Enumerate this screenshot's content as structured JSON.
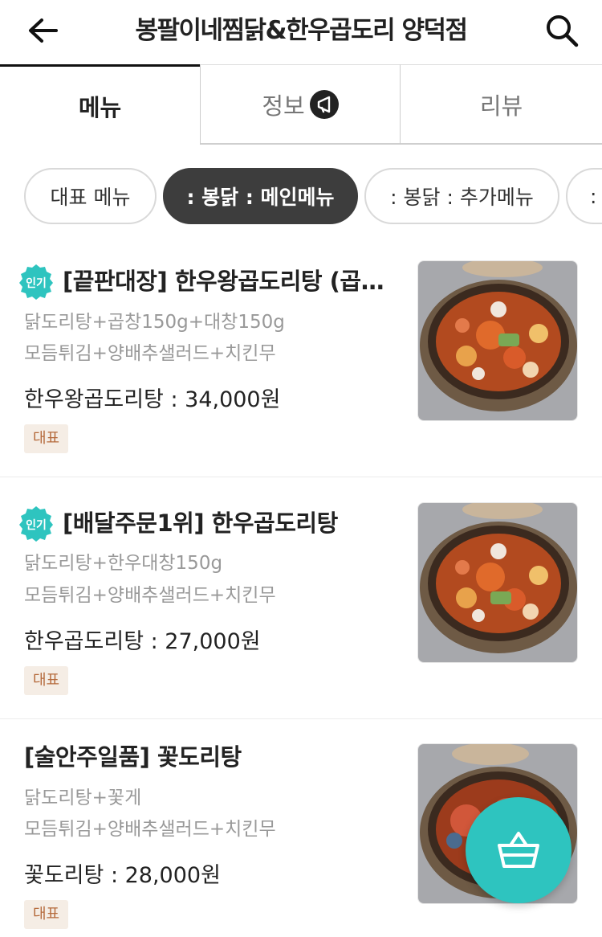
{
  "header": {
    "title": "봉팔이네찜닭&한우곱도리 양덕점",
    "back_icon": "arrow-left-icon",
    "search_icon": "search-icon"
  },
  "tabs": [
    {
      "label": "메뉴",
      "active": true
    },
    {
      "label": "정보",
      "active": false,
      "icon": "megaphone-icon"
    },
    {
      "label": "리뷰",
      "active": false
    }
  ],
  "categories": [
    {
      "label": "대표 메뉴",
      "active": false
    },
    {
      "label": ": 봉닭 : 메인메뉴",
      "active": true
    },
    {
      "label": ": 봉닭 : 추가메뉴",
      "active": false
    },
    {
      "label": ":",
      "active": false
    }
  ],
  "menu_items": [
    {
      "popular_badge": "인기",
      "name": "[끝판대장] 한우왕곱도리탕 (곱창+대창)",
      "desc_line1": "닭도리탕+곱창150g+대창150g",
      "desc_line2": "모듬튀김+양배추샐러드+치킨무",
      "price": "한우왕곱도리탕 : 34,000원",
      "tag": "대표"
    },
    {
      "popular_badge": "인기",
      "name": "[배달주문1위] 한우곱도리탕",
      "desc_line1": "닭도리탕+한우대창150g",
      "desc_line2": "모듬튀김+양배추샐러드+치킨무",
      "price": "한우곱도리탕 : 27,000원",
      "tag": "대표"
    },
    {
      "popular_badge": "",
      "name": "[술안주일품] 꽃도리탕",
      "desc_line1": "닭도리탕+꽃게",
      "desc_line2": "모듬튀김+양배추샐러드+치킨무",
      "price": "꽃도리탕 : 28,000원",
      "tag": "대표"
    }
  ],
  "cart": {
    "icon": "basket-icon"
  },
  "colors": {
    "accent": "#2ec4bf",
    "chip_active": "#3d3d3d",
    "tag_bg": "#f5ede5",
    "tag_text": "#b56a3c",
    "popular_badge": "#2ec4bf"
  }
}
